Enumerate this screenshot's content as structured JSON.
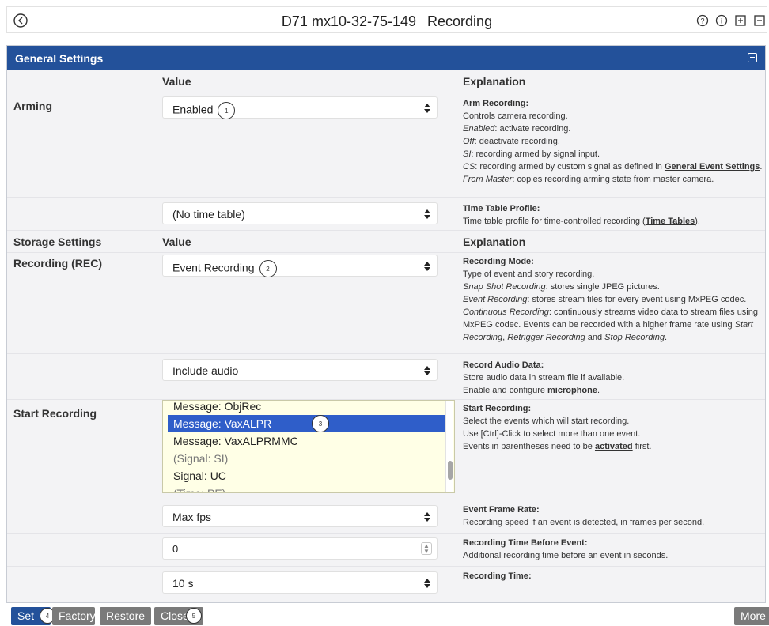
{
  "topbar": {
    "camera": "D71 mx10-32-75-149",
    "page": "Recording"
  },
  "panel": {
    "title": "General Settings"
  },
  "columns": {
    "value": "Value",
    "explanation": "Explanation"
  },
  "arming": {
    "label": "Arming",
    "value": "Enabled",
    "badge": "1",
    "expl_title": "Arm Recording",
    "expl_lines": [
      "Controls camera recording.",
      "Enabled: activate recording.",
      "Off: deactivate recording.",
      "SI: recording armed by signal input.",
      "CS: recording armed by custom signal as defined in General Event Settings.",
      "From Master: copies recording arming state from master camera."
    ],
    "link": "General Event Settings"
  },
  "timetable": {
    "value": "(No time table)",
    "expl_title": "Time Table Profile",
    "expl_text": "Time table profile for time-controlled recording (",
    "link": "Time Tables",
    "expl_end": ")."
  },
  "storage": {
    "label": "Storage Settings",
    "value_head": "Value",
    "expl_head": "Explanation"
  },
  "recording": {
    "label": "Recording (REC)",
    "value": "Event Recording",
    "badge": "2",
    "expl_title": "Recording Mode",
    "l1": "Type of event and story recording.",
    "l2a": "Snap Shot Recording",
    "l2b": ": stores single JPEG pictures.",
    "l3a": "Event Recording",
    "l3b": ": stores stream files for every event using MxPEG codec.",
    "l4a": "Continuous Recording",
    "l4b": ": continuously streams video data to stream files using MxPEG codec. Events can be recorded with a higher frame rate using ",
    "l4c": "Start Recording",
    "l4d": ", ",
    "l4e": "Retrigger Recording",
    "l4f": " and ",
    "l4g": "Stop Recording",
    "l4h": "."
  },
  "audio": {
    "value": "Include audio",
    "expl_title": "Record Audio Data",
    "l1": "Store audio data in stream file if available.",
    "l2": "Enable and configure ",
    "link": "microphone",
    "l2end": "."
  },
  "start": {
    "label": "Start Recording",
    "badge": "3",
    "options": [
      "Message: ObjRec",
      "Message: VaxALPR",
      "Message: VaxALPRMMC",
      "(Signal: SI)",
      "Signal: UC",
      "(Time: PE)"
    ],
    "expl_title": "Start Recording",
    "l1": "Select the events which will start recording.",
    "l2": "Use [Ctrl]-Click to select more than one event.",
    "l3": "Events in parentheses need to be ",
    "link": "activated",
    "l3end": " first."
  },
  "framerate": {
    "value": "Max fps",
    "expl_title": "Event Frame Rate",
    "l1": "Recording speed if an event is detected, in frames per second."
  },
  "before": {
    "value": "0",
    "expl_title": "Recording Time Before Event",
    "l1": "Additional recording time before an event in seconds."
  },
  "rectime": {
    "value": "10 s",
    "expl_title": "Recording Time"
  },
  "bottom": {
    "set": "Set",
    "set_badge": "4",
    "factory": "Factory",
    "restore": "Restore",
    "close": "Close",
    "close_badge": "5",
    "more": "More"
  }
}
